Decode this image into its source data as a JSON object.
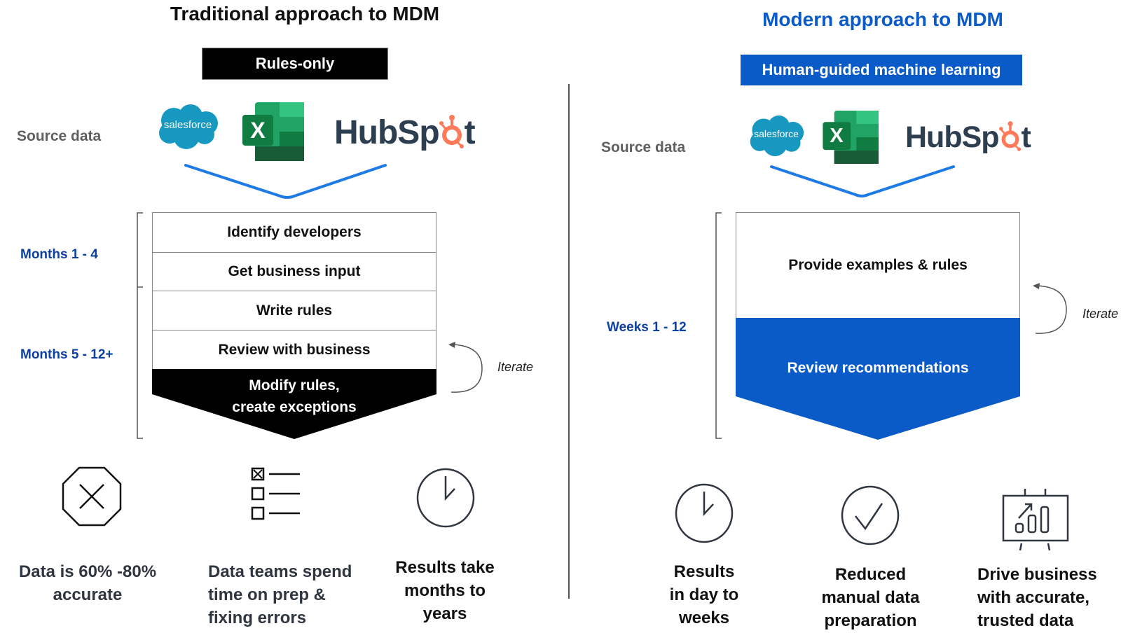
{
  "left": {
    "title": "Traditional approach to MDM",
    "tag": "Rules-only",
    "source_label": "Source data",
    "logos": {
      "salesforce": "salesforce",
      "excel": "X",
      "hubspot_prefix": "HubSp",
      "hubspot_suffix": "t"
    },
    "periods": [
      "Months 1 - 4",
      "Months 5 - 12+"
    ],
    "steps": [
      "Identify developers",
      "Get business input",
      "Write rules",
      "Review with business"
    ],
    "final_step": [
      "Modify rules,",
      "create exceptions"
    ],
    "iterate_label": "Iterate",
    "outcomes": [
      {
        "icon": "stop-x-icon",
        "lines": [
          "Data is 60% -80%",
          "accurate"
        ]
      },
      {
        "icon": "checklist-icon",
        "lines": [
          "Data teams spend",
          "time on prep &",
          "fixing errors"
        ]
      },
      {
        "icon": "clock-icon",
        "lines": [
          "Results take",
          "months to",
          "years"
        ]
      }
    ]
  },
  "right": {
    "title": "Modern approach to MDM",
    "tag": "Human-guided machine learning",
    "source_label": "Source data",
    "logos": {
      "salesforce": "salesforce",
      "excel": "X",
      "hubspot_prefix": "HubSp",
      "hubspot_suffix": "t"
    },
    "period": "Weeks 1 - 12",
    "step": "Provide examples & rules",
    "final_step": "Review recommendations",
    "iterate_label": "Iterate",
    "outcomes": [
      {
        "icon": "clock-icon",
        "lines": [
          "Results",
          "in day to",
          "weeks"
        ]
      },
      {
        "icon": "checkmark-circle-icon",
        "lines": [
          "Reduced",
          "manual data",
          "preparation"
        ]
      },
      {
        "icon": "presentation-chart-icon",
        "lines": [
          "Drive business",
          "with accurate,",
          "trusted data"
        ]
      }
    ]
  },
  "colors": {
    "accent_blue": "#0a5ac8",
    "period_blue": "#0b3fa0",
    "funnel_blue": "#1e7be6",
    "salesforce_blue": "#1798c1",
    "hubspot_orange": "#ff7a59",
    "hubspot_navy": "#2d3e50"
  }
}
